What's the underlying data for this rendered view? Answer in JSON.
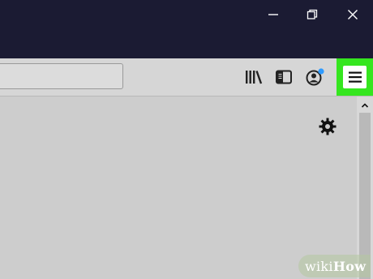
{
  "window_controls": {
    "minimize_icon": "minimize-icon",
    "restore_icon": "restore-icon",
    "close_icon": "close-icon"
  },
  "toolbar": {
    "address_bar_value": "",
    "icons": [
      "library-icon",
      "sidebar-icon",
      "account-icon",
      "hamburger-menu-icon"
    ],
    "account_badge_color": "#2f9bff",
    "menu_highlight_color": "#35e61f"
  },
  "content": {
    "settings_icon": "gear-icon",
    "scroll_up_icon": "chevron-up-icon"
  },
  "watermark": {
    "part1": "wiki",
    "part2": "How"
  },
  "colors": {
    "titlebar": "#1b1b33",
    "toolbar": "#d6d6d6",
    "content": "#cdcdcd"
  }
}
